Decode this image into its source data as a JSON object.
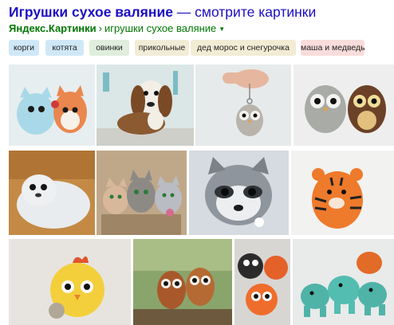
{
  "header": {
    "title_bold": "Игрушки сухое валяние",
    "title_rest": " — смотрите картинки",
    "site": "Яндекс.Картинки",
    "separator": "›",
    "page": "игрушки сухое валяние",
    "dropdown_icon": "triangle-down-icon"
  },
  "tags": [
    {
      "label": "корги",
      "color": "#cfe8f7"
    },
    {
      "label": "котята",
      "color": "#cfe8f7"
    },
    {
      "label": "овинки",
      "color": "#dfeedd"
    },
    {
      "label": "прикольные",
      "color": "#f1ecd6"
    },
    {
      "label": "дед морос и снегурочка",
      "color": "#f3ecd5"
    },
    {
      "label": "маша и медведь",
      "color": "#f9dcdc"
    }
  ],
  "images": [
    {
      "subject": "blue cat and orange fox felted toys"
    },
    {
      "subject": "felted basset hound puppy"
    },
    {
      "subject": "hand holding small felted owl keychain"
    },
    {
      "subject": "grey and brown felted owls"
    },
    {
      "subject": "white felted seal pup"
    },
    {
      "subject": "three felted kittens"
    },
    {
      "subject": "felted raccoon"
    },
    {
      "subject": "orange striped felted tiger"
    },
    {
      "subject": "yellow felted chick with coin"
    },
    {
      "subject": "two felted brown owls"
    },
    {
      "subject": "round felted animal balls"
    },
    {
      "subject": "turquoise and orange felted elephants"
    }
  ]
}
